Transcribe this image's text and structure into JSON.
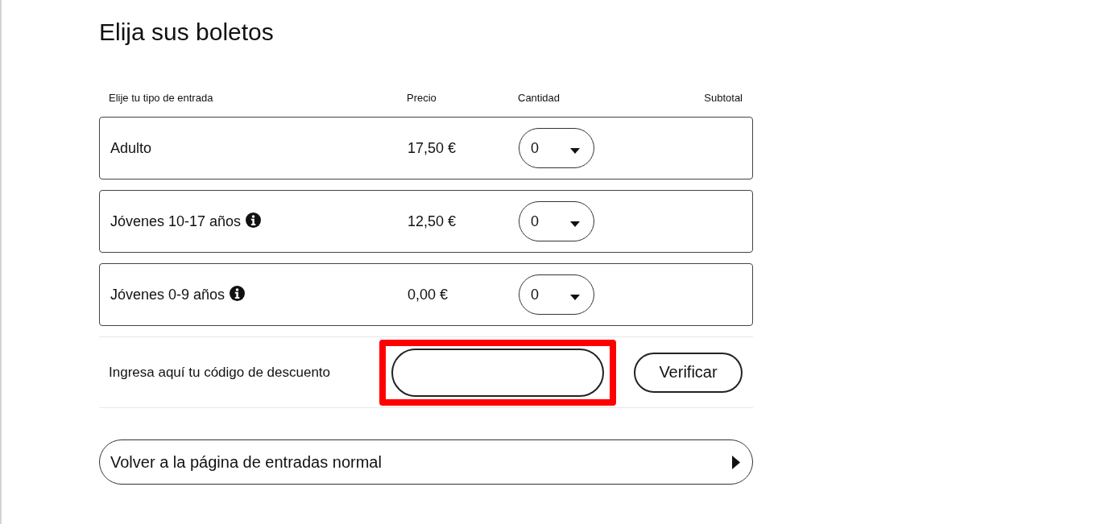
{
  "page": {
    "title": "Elija sus boletos"
  },
  "table": {
    "columns": [
      "Elije tu tipo de entrada",
      "Precio",
      "Cantidad",
      "Subtotal"
    ],
    "rows": [
      {
        "ticket_type": "Adulto",
        "info": false,
        "price": "17,50 €",
        "quantity": "0"
      },
      {
        "ticket_type": "Jóvenes 10-17 años",
        "info": true,
        "price": "12,50 €",
        "quantity": "0"
      },
      {
        "ticket_type": "Jóvenes 0-9 años",
        "info": true,
        "price": "0,00 €",
        "quantity": "0"
      }
    ]
  },
  "discount": {
    "label": "Ingresa aquí tu código de descuento",
    "highlighted": true,
    "button": "Verificar"
  },
  "back_link": {
    "label": "Volver a la página de entradas normal"
  }
}
